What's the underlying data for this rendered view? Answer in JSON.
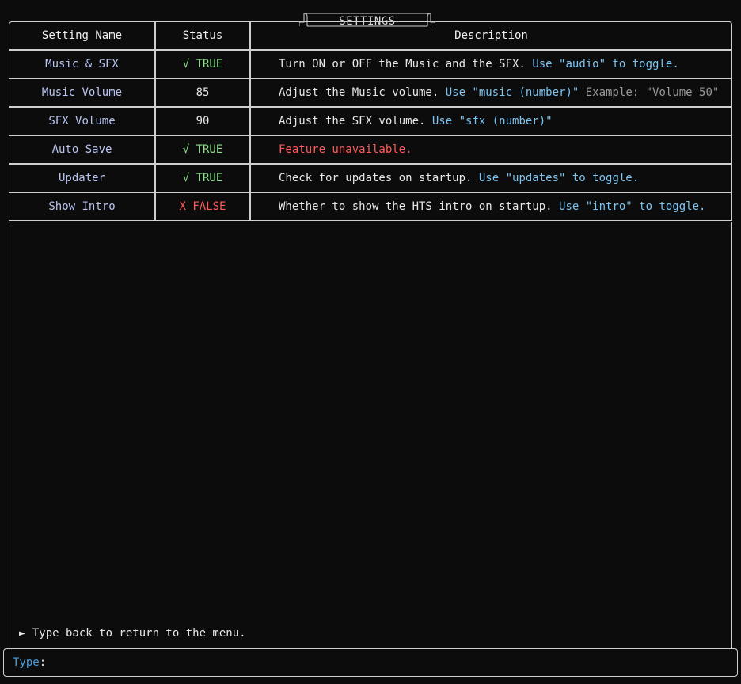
{
  "title": "SETTINGS",
  "headers": {
    "name": "Setting Name",
    "status": "Status",
    "description": "Description"
  },
  "rows": [
    {
      "name": "Music & SFX",
      "status": "√ TRUE",
      "status_kind": "ok",
      "desc_main": "Turn ON or OFF the Music and the SFX.",
      "desc_hint": "Use \"audio\" to toggle.",
      "desc_ex": ""
    },
    {
      "name": "Music Volume",
      "status": "85",
      "status_kind": "num",
      "desc_main": "Adjust the Music volume.",
      "desc_hint": "Use \"music (number)\"",
      "desc_ex": "Example: \"Volume 50\""
    },
    {
      "name": "SFX Volume",
      "status": "90",
      "status_kind": "num",
      "desc_main": "Adjust the SFX volume.",
      "desc_hint": "Use \"sfx (number)\"",
      "desc_ex": ""
    },
    {
      "name": "Auto Save",
      "status": "√ TRUE",
      "status_kind": "ok",
      "desc_err": "Feature unavailable."
    },
    {
      "name": "Updater",
      "status": "√ TRUE",
      "status_kind": "ok",
      "desc_main": "Check for updates on startup.",
      "desc_hint": "Use \"updates\" to toggle.",
      "desc_ex": ""
    },
    {
      "name": "Show Intro",
      "status": "X FALSE",
      "status_kind": "bad",
      "desc_main": "Whether to show the HTS intro on startup.",
      "desc_hint": "Use \"intro\" to toggle.",
      "desc_ex": ""
    }
  ],
  "back_hint": "► Type back to return to the menu.",
  "prompt": {
    "label": "Type",
    "colon": ":",
    "value": ""
  },
  "colors": {
    "background": "#0c0c0c",
    "border": "#cfcfcf",
    "setting_name": "#b9c4f2",
    "true": "#8be08b",
    "false": "#ff5a5a",
    "hint": "#7cc4f2",
    "prompt_label": "#4a9fe0"
  }
}
